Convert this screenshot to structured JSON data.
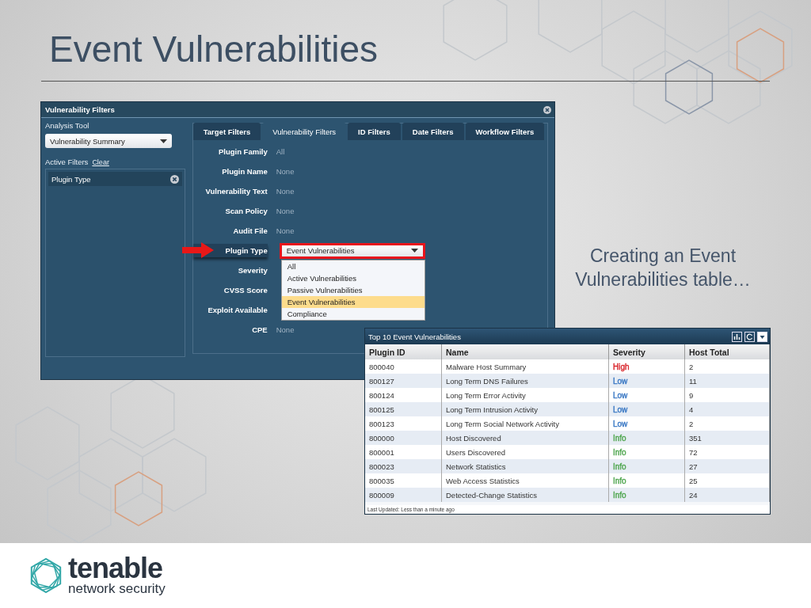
{
  "slide": {
    "title": "Event Vulnerabilities",
    "caption": "Creating an Event Vulnerabilities table…"
  },
  "filter_window": {
    "title": "Vulnerability Filters",
    "analysis_tool": {
      "label": "Analysis Tool",
      "value": "Vulnerability Summary"
    },
    "active_filters": {
      "label": "Active Filters",
      "clear_link": "Clear",
      "items": [
        "Plugin Type"
      ]
    },
    "tabs": [
      {
        "label": "Target Filters",
        "selected": false
      },
      {
        "label": "Vulnerability Filters",
        "selected": true
      },
      {
        "label": "ID Filters",
        "selected": false
      },
      {
        "label": "Date Filters",
        "selected": false
      },
      {
        "label": "Workflow Filters",
        "selected": false
      }
    ],
    "filters": [
      {
        "kind": "text",
        "label": "Plugin Family",
        "value": "All"
      },
      {
        "kind": "text",
        "label": "Plugin Name",
        "value": "None"
      },
      {
        "kind": "text",
        "label": "Vulnerability Text",
        "value": "None"
      },
      {
        "kind": "text",
        "label": "Scan Policy",
        "value": "None"
      },
      {
        "kind": "text",
        "label": "Audit File",
        "value": "None"
      },
      {
        "kind": "select",
        "label": "Plugin Type",
        "value": "Event Vulnerabilities",
        "highlighted": true,
        "expanded": true,
        "options": [
          {
            "label": "All",
            "selected": false
          },
          {
            "label": "Active Vulnerabilities",
            "selected": false
          },
          {
            "label": "Passive Vulnerabilities",
            "selected": false
          },
          {
            "label": "Event Vulnerabilities",
            "selected": true
          },
          {
            "label": "Compliance",
            "selected": false
          }
        ]
      },
      {
        "kind": "text",
        "label": "Severity"
      },
      {
        "kind": "text",
        "label": "CVSS Score"
      },
      {
        "kind": "text",
        "label": "Exploit Available"
      },
      {
        "kind": "text",
        "label": "CPE",
        "value": "None"
      }
    ]
  },
  "table_window": {
    "title": "Top 10 Event Vulnerabilities",
    "columns": [
      "Plugin ID",
      "Name",
      "Severity",
      "Host Total"
    ],
    "rows": [
      {
        "plugin_id": "800040",
        "name": "Malware Host Summary",
        "severity": "High",
        "color": "#d9262c",
        "host_total": "2"
      },
      {
        "plugin_id": "800127",
        "name": "Long Term DNS Failures",
        "severity": "Low",
        "color": "#3a78c4",
        "host_total": "11"
      },
      {
        "plugin_id": "800124",
        "name": "Long Term Error Activity",
        "severity": "Low",
        "color": "#3a78c4",
        "host_total": "9"
      },
      {
        "plugin_id": "800125",
        "name": "Long Term Intrusion Activity",
        "severity": "Low",
        "color": "#3a78c4",
        "host_total": "4"
      },
      {
        "plugin_id": "800123",
        "name": "Long Term Social Network Activity",
        "severity": "Low",
        "color": "#3a78c4",
        "host_total": "2"
      },
      {
        "plugin_id": "800000",
        "name": "Host Discovered",
        "severity": "Info",
        "color": "#4fa64f",
        "host_total": "351"
      },
      {
        "plugin_id": "800001",
        "name": "Users Discovered",
        "severity": "Info",
        "color": "#4fa64f",
        "host_total": "72"
      },
      {
        "plugin_id": "800023",
        "name": "Network Statistics",
        "severity": "Info",
        "color": "#4fa64f",
        "host_total": "27"
      },
      {
        "plugin_id": "800035",
        "name": "Web Access Statistics",
        "severity": "Info",
        "color": "#4fa64f",
        "host_total": "25"
      },
      {
        "plugin_id": "800009",
        "name": "Detected-Change Statistics",
        "severity": "Info",
        "color": "#4fa64f",
        "host_total": "24"
      }
    ],
    "footer": "Last Updated: Less than a minute ago"
  },
  "logo": {
    "name": "tenable",
    "tagline": "network security"
  }
}
